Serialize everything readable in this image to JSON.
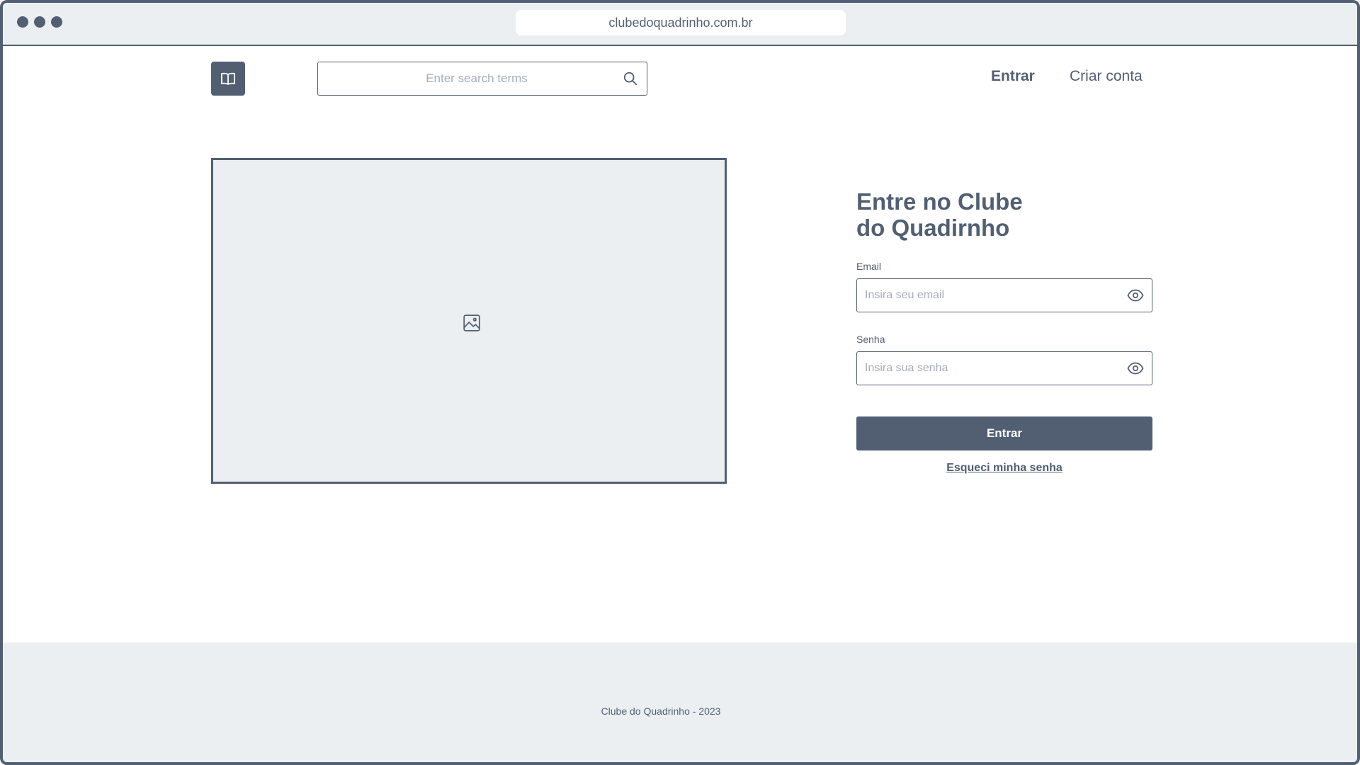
{
  "browser": {
    "url": "clubedoquadrinho.com.br"
  },
  "header": {
    "logo_icon": "book-icon",
    "search": {
      "placeholder": "Enter search terms",
      "icon": "search-icon"
    },
    "nav": {
      "login_label": "Entrar",
      "signup_label": "Criar conta"
    }
  },
  "hero": {
    "icon": "image-icon"
  },
  "login_form": {
    "title_line1": "Entre no Clube",
    "title_line2": "do Quadirnho",
    "email": {
      "label": "Email",
      "placeholder": "Insira seu email",
      "value": "",
      "icon": "eye-icon"
    },
    "password": {
      "label": "Senha",
      "placeholder": "Insira sua senha",
      "value": "",
      "icon": "eye-icon"
    },
    "submit_label": "Entrar",
    "forgot_label": "Esqueci minha senha"
  },
  "footer": {
    "text": "Clube do Quadrinho - 2023"
  },
  "colors": {
    "primary": "#525f72",
    "surface": "#eceff2",
    "placeholder": "#a4adb8",
    "background": "#ffffff"
  }
}
